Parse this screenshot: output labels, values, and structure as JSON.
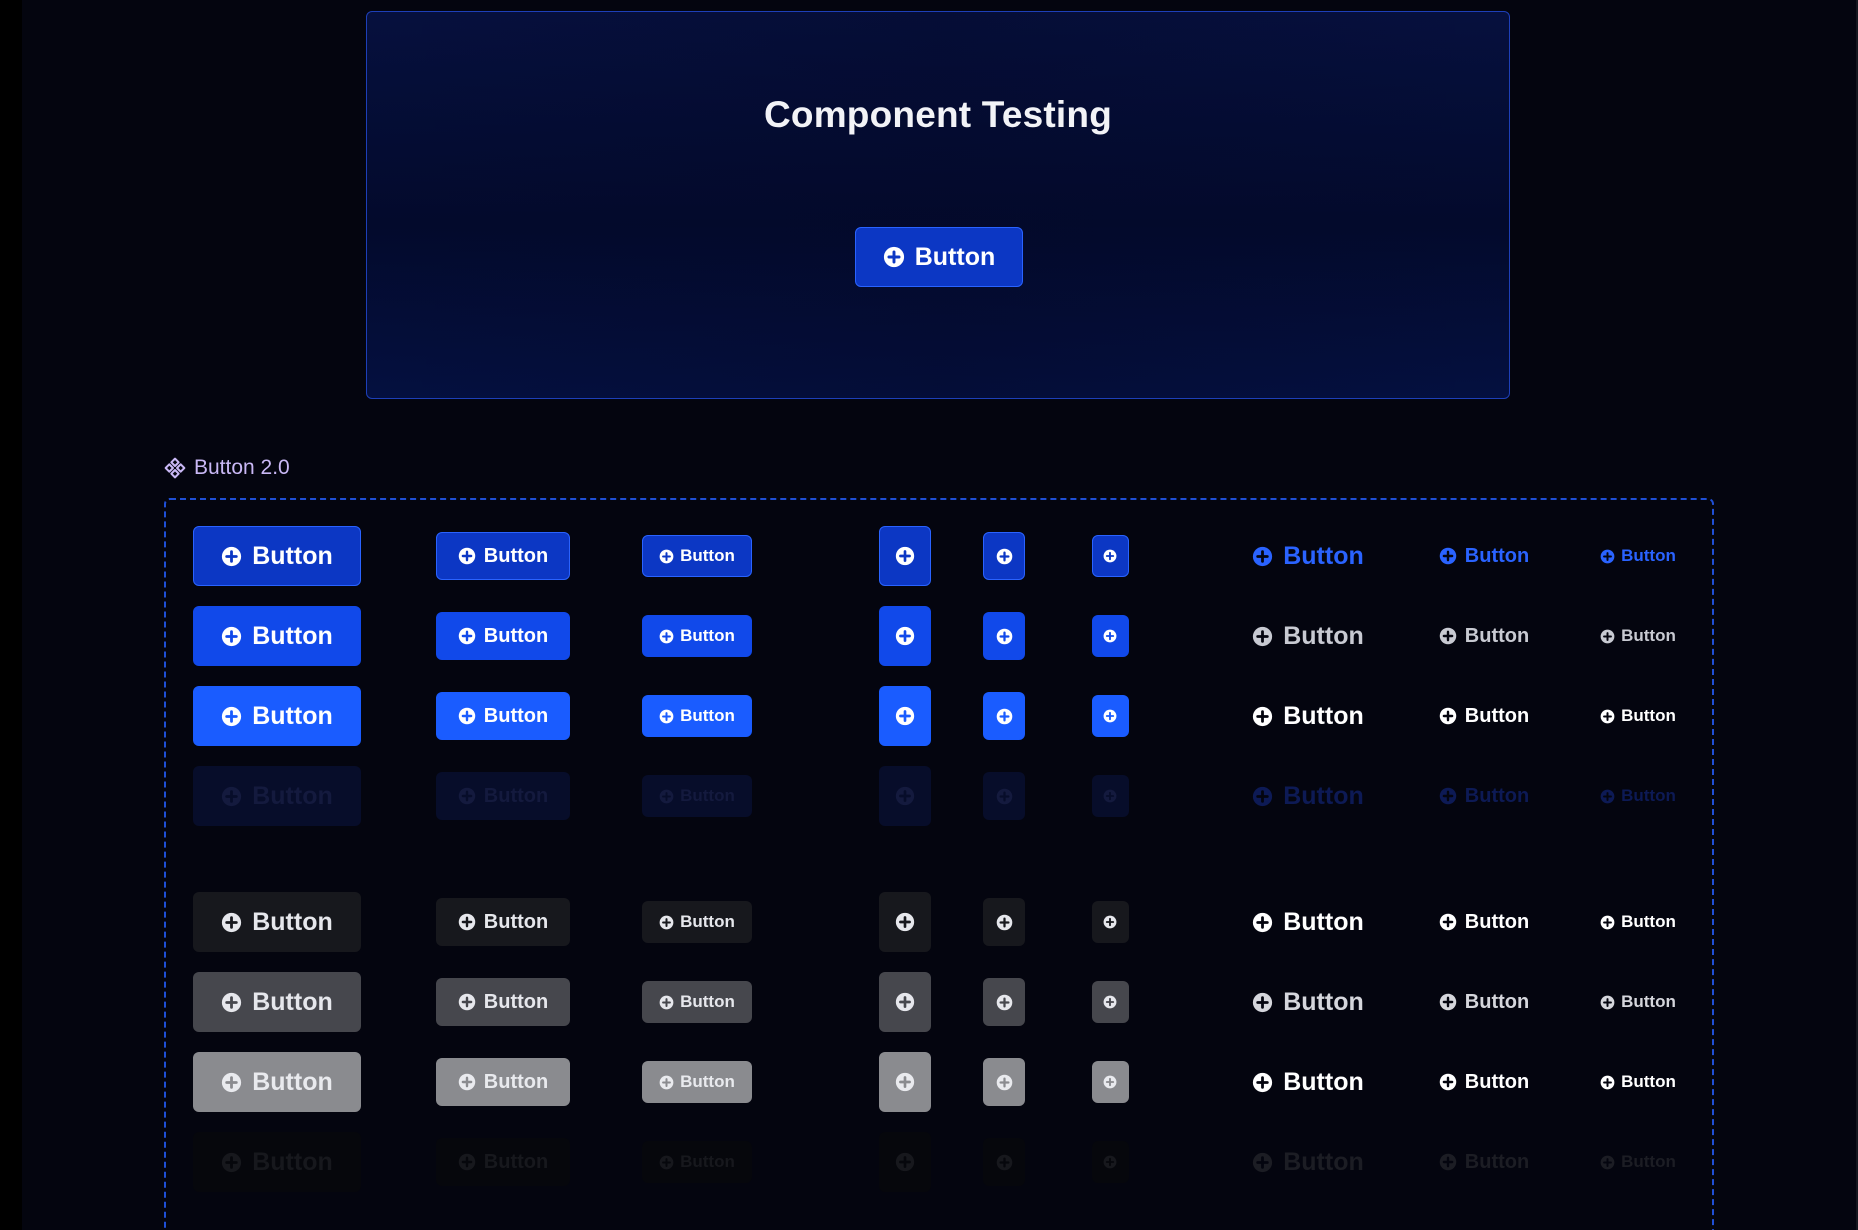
{
  "preview": {
    "title": "Component Testing",
    "button_label": "Button",
    "icon": "plus-circle-icon"
  },
  "component_set": {
    "icon": "component-icon",
    "name": "Button 2.0",
    "button_label": "Button"
  },
  "variants": [
    {
      "name": "primary-default",
      "fill": "#0c37c4",
      "border": "#2a63ff",
      "text": "#ffffff",
      "ghost_text": "#2a63ff"
    },
    {
      "name": "primary-hover",
      "fill": "#1149ea",
      "border": "#1149ea",
      "text": "#ffffff",
      "ghost_text": "#c8cad2"
    },
    {
      "name": "primary-pressed",
      "fill": "#1a5cff",
      "border": "#1a5cff",
      "text": "#ffffff",
      "ghost_text": "#ffffff"
    },
    {
      "name": "primary-disabled",
      "fill": "#070d2a",
      "border": "#070d2a",
      "text": "#141a3e",
      "ghost_text": "#0d1a55"
    },
    {
      "name": "secondary-default",
      "fill": "#17181d",
      "border": "#17181d",
      "text": "#e6e7ec",
      "ghost_text": "#ffffff"
    },
    {
      "name": "secondary-hover",
      "fill": "#46474d",
      "border": "#46474d",
      "text": "#e6e7ec",
      "ghost_text": "#d5d6dc"
    },
    {
      "name": "secondary-pressed",
      "fill": "#8a8b8f",
      "border": "#8a8b8f",
      "text": "#e9eaee",
      "ghost_text": "#ffffff"
    },
    {
      "name": "secondary-disabled",
      "fill": "#06070c",
      "border": "#06070c",
      "text": "#17181d",
      "ghost_text": "#1c1d24"
    }
  ]
}
